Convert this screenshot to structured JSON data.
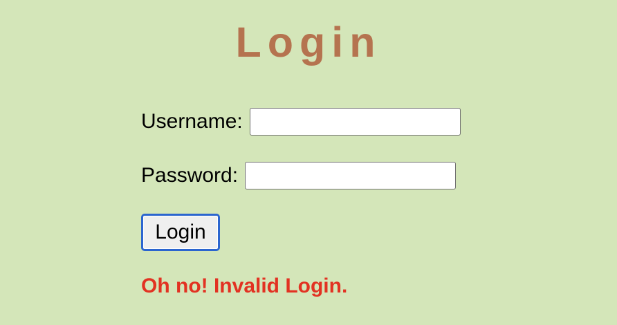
{
  "page": {
    "title": "Login"
  },
  "form": {
    "username_label": "Username:",
    "username_value": "",
    "password_label": "Password:",
    "password_value": "",
    "submit_label": "Login"
  },
  "error": {
    "message": "Oh no! Invalid Login."
  },
  "colors": {
    "background": "#d4e6b9",
    "title": "#b5734f",
    "error": "#e23222",
    "button_focus_border": "#2b65cf"
  }
}
